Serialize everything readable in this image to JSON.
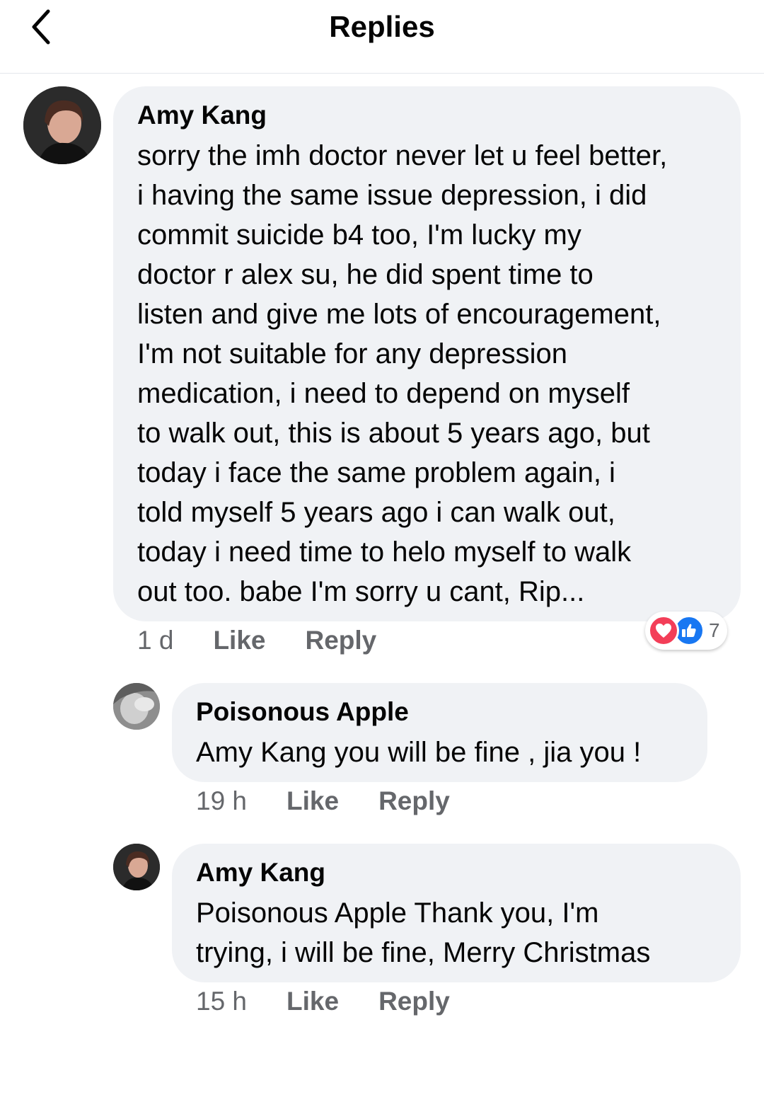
{
  "header": {
    "title": "Replies",
    "back_icon": "chevron-left-icon"
  },
  "colors": {
    "bubble": "#f0f2f5",
    "meta_text": "#65676b",
    "love_reaction": "#f33e58",
    "like_reaction": "#1877f2"
  },
  "comment": {
    "author": "Amy Kang",
    "text": "sorry the imh doctor never let u feel better,\ni having the same issue depression,  i did\ncommit suicide b4 too,  I'm lucky my\ndoctor r alex su,  he did spent time to\nlisten and give me lots of encouragement,\nI'm not suitable for any depression\nmedication,  i need to depend on myself\nto walk out,  this is about 5 years ago,  but\ntoday i face the same problem again,  i\ntold myself  5 years ago i can walk out,\ntoday i need time to helo myself to walk\nout too.  babe I'm sorry u cant,  Rip...",
    "time": "1 d",
    "like_label": "Like",
    "reply_label": "Reply",
    "reactions": {
      "icons": [
        "heart-icon",
        "thumbs-up-icon"
      ],
      "count": "7"
    }
  },
  "replies": [
    {
      "author": "Poisonous Apple",
      "text": "Amy Kang you will be fine , jia you !",
      "time": "19 h",
      "like_label": "Like",
      "reply_label": "Reply"
    },
    {
      "author": "Amy Kang",
      "text": "Poisonous Apple Thank you,  I'm\ntrying,  i will be fine,  Merry Christmas",
      "time": "15 h",
      "like_label": "Like",
      "reply_label": "Reply"
    }
  ]
}
